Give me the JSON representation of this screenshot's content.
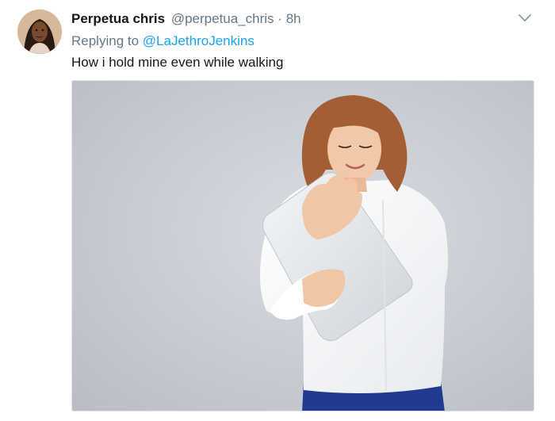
{
  "tweet": {
    "display_name": "Perpetua chris",
    "handle": "@perpetua_chris",
    "separator": "·",
    "time": "8h",
    "replying_prefix": "Replying to",
    "reply_to": "@LaJethroJenkins",
    "text": "How i hold mine even while walking",
    "caret_icon": "chevron-down-icon",
    "image_icon": "photo-woman-hugging-laptop"
  },
  "colors": {
    "link": "#1da1f2",
    "secondary_text": "#657786",
    "primary_text": "#14171a",
    "photo_background": "#c8ccd3"
  }
}
